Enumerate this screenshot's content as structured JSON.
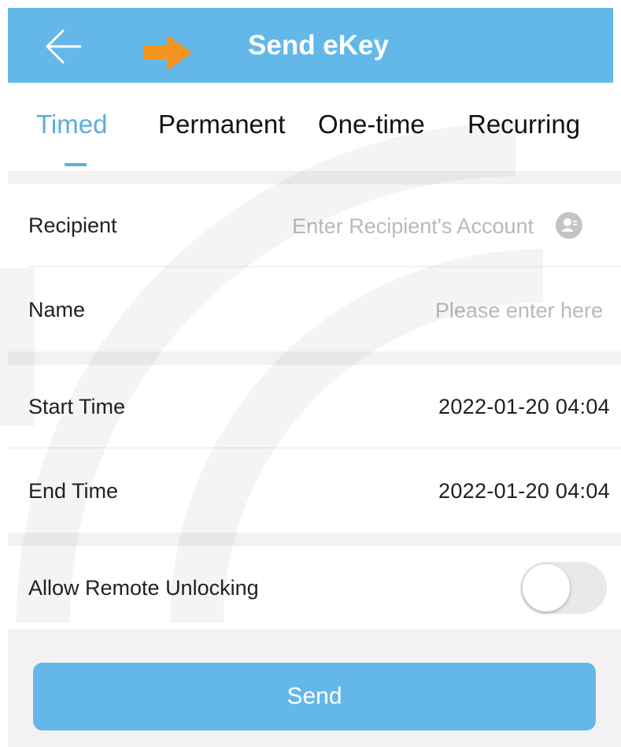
{
  "header": {
    "title": "Send eKey",
    "back_icon": "arrow-left-icon",
    "annotation_icon": "orange-arrow-right-icon",
    "background_color": "#63b8e9",
    "annotation_color": "#f39621"
  },
  "tabs": [
    {
      "label": "Timed",
      "active": true
    },
    {
      "label": "Permanent",
      "active": false
    },
    {
      "label": "One-time",
      "active": false
    },
    {
      "label": "Recurring",
      "active": false
    }
  ],
  "form": {
    "recipient": {
      "label": "Recipient",
      "placeholder": "Enter Recipient's Account",
      "value": "",
      "icon": "contact-book-icon"
    },
    "name": {
      "label": "Name",
      "placeholder": "Please enter here",
      "value": ""
    },
    "start_time": {
      "label": "Start Time",
      "value": "2022-01-20 04:04"
    },
    "end_time": {
      "label": "End Time",
      "value": "2022-01-20 04:04"
    },
    "remote_unlock": {
      "label": "Allow Remote Unlocking",
      "enabled": false
    }
  },
  "send_button": {
    "label": "Send"
  },
  "colors": {
    "accent": "#5aaee0",
    "section_gap": "#f2f2f2",
    "placeholder": "#b9b9b9"
  }
}
